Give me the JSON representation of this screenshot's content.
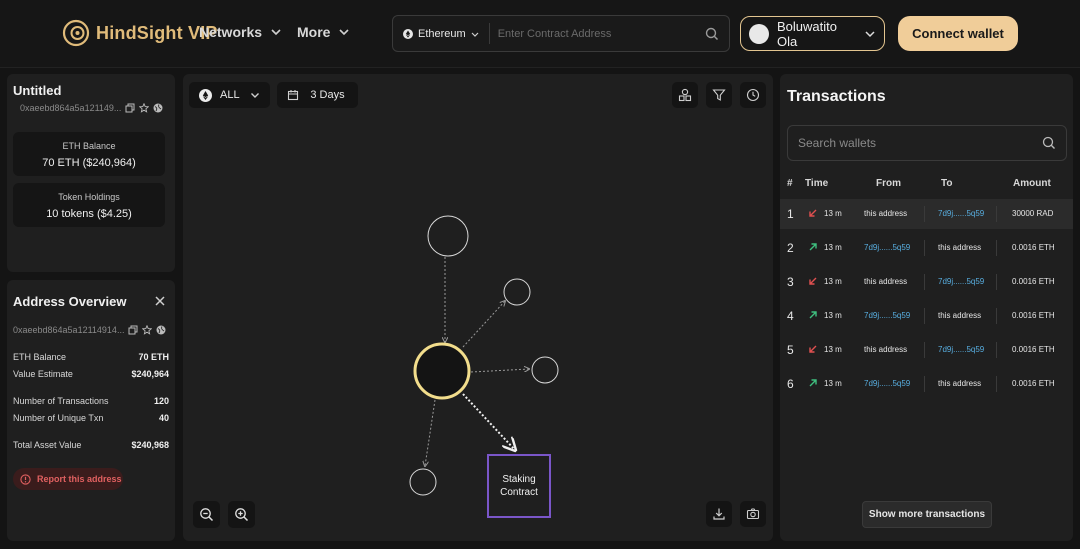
{
  "header": {
    "brand": "HindSight VIP",
    "nav": [
      {
        "label": "Networks"
      },
      {
        "label": "More"
      }
    ],
    "search": {
      "network": "Ethereum",
      "placeholder": "Enter Contract Address"
    },
    "user": {
      "name": "Boluwatito Ola"
    },
    "connect_label": "Connect wallet"
  },
  "wallet_card": {
    "title": "Untitled",
    "address": "0xaeebd864a5a121149...",
    "eth_balance_label": "ETH Balance",
    "eth_balance_value": "70 ETH ($240,964)",
    "token_label": "Token Holdings",
    "token_value": "10 tokens ($4.25)"
  },
  "overview": {
    "title": "Address Overview",
    "address": "0xaeebd864a5a12114914...",
    "rows": [
      {
        "label": "ETH Balance",
        "value": "70 ETH"
      },
      {
        "label": "Value Estimate",
        "value": "$240,964"
      },
      {
        "label": "Number of Transactions",
        "value": "120"
      },
      {
        "label": "Number of Unique Txn",
        "value": "40"
      },
      {
        "label": "Total Asset Value",
        "value": "$240,968"
      }
    ],
    "report_label": "Report this address"
  },
  "graph": {
    "filter_label": "ALL",
    "range_label": "3 Days",
    "staking_label": "Staking Contract"
  },
  "transactions": {
    "title": "Transactions",
    "search_placeholder": "Search wallets",
    "columns": [
      "#",
      "Time",
      "From",
      "To",
      "Amount"
    ],
    "rows": [
      {
        "n": "1",
        "dir": "out",
        "time": "13 m",
        "from": "this address",
        "to": "7d9j......5q59",
        "amount": "30000 RAD"
      },
      {
        "n": "2",
        "dir": "in",
        "time": "13 m",
        "from": "7d9j......5q59",
        "to": "this address",
        "amount": "0.0016 ETH"
      },
      {
        "n": "3",
        "dir": "out",
        "time": "13 m",
        "from": "this address",
        "to": "7d9j......5q59",
        "amount": "0.0016 ETH"
      },
      {
        "n": "4",
        "dir": "in",
        "time": "13 m",
        "from": "7d9j......5q59",
        "to": "this address",
        "amount": "0.0016 ETH"
      },
      {
        "n": "5",
        "dir": "out",
        "time": "13 m",
        "from": "this address",
        "to": "7d9j......5q59",
        "amount": "0.0016 ETH"
      },
      {
        "n": "6",
        "dir": "in",
        "time": "13 m",
        "from": "7d9j......5q59",
        "to": "this address",
        "amount": "0.0016 ETH"
      }
    ],
    "show_more_label": "Show more transactions"
  },
  "colors": {
    "accent": "#f0cd99",
    "brand": "#e0bb7a",
    "out_arrow": "#e05050",
    "in_arrow": "#3fbf7f",
    "link": "#58aee0",
    "staking_border": "#7a56c9",
    "center_node": "#f2dd8c"
  },
  "icons": {
    "logo": "hindsight-logo-icon",
    "network": "ethereum-icon",
    "search": "search-icon",
    "chevron": "chevron-down-icon",
    "copy": "copy-icon",
    "star": "star-icon",
    "globe": "globe-icon",
    "close": "close-icon",
    "alert": "alert-circle-icon",
    "calendar": "calendar-icon",
    "shapes": "shapes-icon",
    "filter": "filter-icon",
    "history": "history-icon",
    "zoom_out": "zoom-out-icon",
    "zoom_in": "zoom-in-icon",
    "download": "download-icon",
    "camera": "camera-icon",
    "arrow_out": "arrow-down-left-icon",
    "arrow_in": "arrow-up-right-icon"
  }
}
